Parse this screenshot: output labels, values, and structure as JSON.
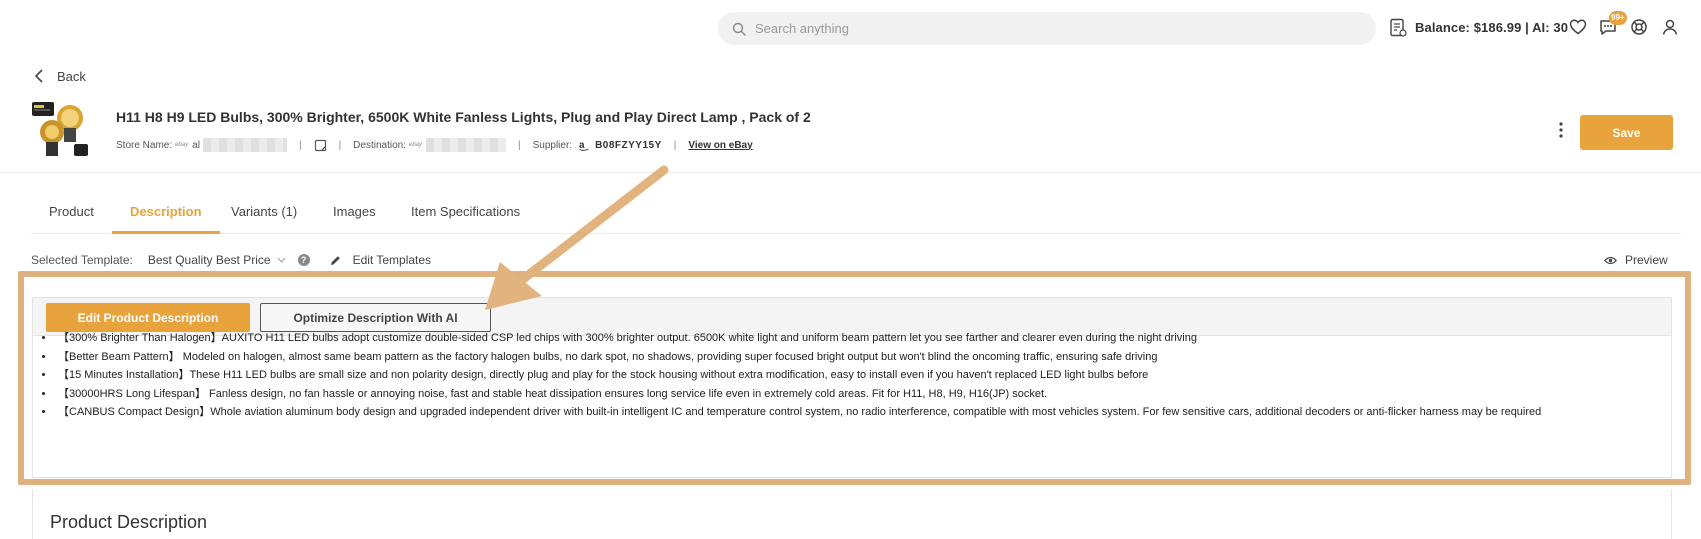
{
  "search": {
    "placeholder": "Search anything"
  },
  "account": {
    "balance_text": "Balance: $186.99 | AI: 30",
    "notifications_badge": "99+"
  },
  "nav": {
    "back_label": "Back"
  },
  "product": {
    "title": "H11 H8 H9 LED Bulbs, 300% Brighter, 6500K White Fanless Lights, Plug and Play Direct Lamp , Pack of 2",
    "store_label": "Store Name:",
    "store_marketplace": "ebay",
    "store_value_partial": "al",
    "destination_label": "Destination:",
    "destination_marketplace": "ebay",
    "supplier_label": "Supplier:",
    "supplier_icon": "amazon-icon",
    "supplier_sku": "B08FZYY15Y",
    "view_link": "View on eBay",
    "save_label": "Save"
  },
  "tabs": [
    {
      "label": "Product",
      "active": false
    },
    {
      "label": "Description",
      "active": true
    },
    {
      "label": "Variants (1)",
      "active": false
    },
    {
      "label": "Images",
      "active": false
    },
    {
      "label": "Item Specifications",
      "active": false
    }
  ],
  "template": {
    "label": "Selected Template:",
    "selected": "Best Quality Best Price",
    "edit_label": "Edit Templates",
    "preview_label": "Preview"
  },
  "description": {
    "edit_button": "Edit Product Description",
    "optimize_button": "Optimize Description With AI",
    "bullets": [
      "【300% Brighter Than Halogen】AUXITO H11 LED bulbs adopt customize double-sided CSP led chips with 300% brighter output. 6500K white light and uniform beam pattern let you see farther and clearer even during the night driving",
      "【Better Beam Pattern】 Modeled on halogen, almost same beam pattern as the factory halogen bulbs, no dark spot, no shadows, providing super focused bright output but won't blind the oncoming traffic, ensuring safe driving",
      "【15 Minutes Installation】These H11 LED bulbs are small size and non polarity design, directly plug and play for the stock housing without extra modification, easy to install even if you haven't replaced LED light bulbs before",
      "【30000HRS Long Lifespan】 Fanless design, no fan hassle or annoying noise, fast and stable heat dissipation ensures long service life even in extremely cold areas. Fit for H11, H8, H9, H16(JP) socket.",
      "【CANBUS Compact Design】Whole aviation aluminum body design and upgraded independent driver with built-in intelligent IC and temperature control system, no radio interference, compatible with most vehicles system. For few sensitive cars, additional decoders or anti-flicker harness may be required"
    ],
    "section_title": "Product Description"
  },
  "colors": {
    "accent": "#e8a33d",
    "highlight": "#dfb17f"
  }
}
